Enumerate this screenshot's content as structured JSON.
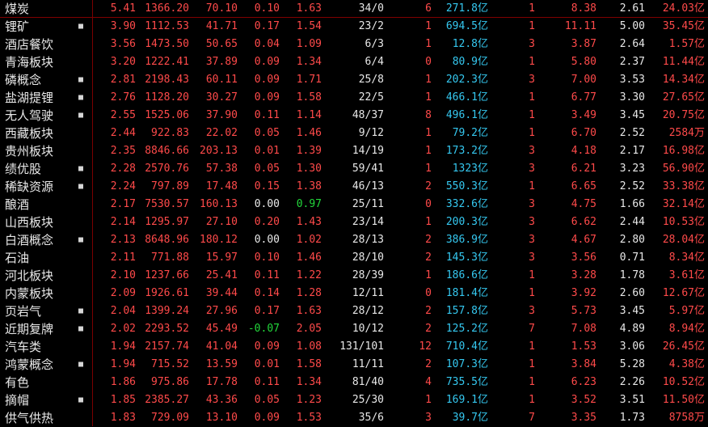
{
  "colors": {
    "up": "#ff4a4a",
    "down": "#22d63a",
    "flat": "#e8e8e8",
    "amount": "#35c8f0",
    "divider": "#7a0000"
  },
  "rows": [
    {
      "name": "煤炭",
      "dot": "",
      "c1": "5.41",
      "c2": "1366.20",
      "c3": "70.10",
      "c4": "0.10",
      "c5": "1.63",
      "c6": "34/0",
      "c7": "6",
      "c8": "271.8亿",
      "c9": "1",
      "c10": "8.38",
      "c11": "2.61",
      "c12": "24.03亿"
    },
    {
      "name": "锂矿",
      "dot": "■",
      "c1": "3.90",
      "c2": "1112.53",
      "c3": "41.71",
      "c4": "0.17",
      "c5": "1.54",
      "c6": "23/2",
      "c7": "1",
      "c8": "694.5亿",
      "c9": "1",
      "c10": "11.11",
      "c11": "5.00",
      "c12": "35.45亿"
    },
    {
      "name": "酒店餐饮",
      "dot": "",
      "c1": "3.56",
      "c2": "1473.50",
      "c3": "50.65",
      "c4": "0.04",
      "c5": "1.09",
      "c6": "6/3",
      "c7": "1",
      "c8": "12.8亿",
      "c9": "3",
      "c10": "3.87",
      "c11": "2.64",
      "c12": "1.57亿"
    },
    {
      "name": "青海板块",
      "dot": "",
      "c1": "3.20",
      "c2": "1222.41",
      "c3": "37.89",
      "c4": "0.09",
      "c5": "1.34",
      "c6": "6/4",
      "c7": "0",
      "c8": "80.9亿",
      "c9": "1",
      "c10": "5.80",
      "c11": "2.37",
      "c12": "11.44亿"
    },
    {
      "name": "磷概念",
      "dot": "■",
      "c1": "2.81",
      "c2": "2198.43",
      "c3": "60.11",
      "c4": "0.09",
      "c5": "1.71",
      "c6": "25/8",
      "c7": "1",
      "c8": "202.3亿",
      "c9": "3",
      "c10": "7.00",
      "c11": "3.53",
      "c12": "14.34亿"
    },
    {
      "name": "盐湖提锂",
      "dot": "■",
      "c1": "2.76",
      "c2": "1128.20",
      "c3": "30.27",
      "c4": "0.09",
      "c5": "1.58",
      "c6": "22/5",
      "c7": "1",
      "c8": "466.1亿",
      "c9": "1",
      "c10": "6.77",
      "c11": "3.30",
      "c12": "27.65亿"
    },
    {
      "name": "无人驾驶",
      "dot": "■",
      "c1": "2.55",
      "c2": "1525.06",
      "c3": "37.90",
      "c4": "0.11",
      "c5": "1.14",
      "c6": "48/37",
      "c7": "8",
      "c8": "496.1亿",
      "c9": "1",
      "c10": "3.49",
      "c11": "3.45",
      "c12": "20.75亿"
    },
    {
      "name": "西藏板块",
      "dot": "",
      "c1": "2.44",
      "c2": "922.83",
      "c3": "22.02",
      "c4": "0.05",
      "c5": "1.46",
      "c6": "9/12",
      "c7": "1",
      "c8": "79.2亿",
      "c9": "1",
      "c10": "6.70",
      "c11": "2.52",
      "c12": "2584万"
    },
    {
      "name": "贵州板块",
      "dot": "",
      "c1": "2.35",
      "c2": "8846.66",
      "c3": "203.13",
      "c4": "0.01",
      "c5": "1.39",
      "c6": "14/19",
      "c7": "1",
      "c8": "173.2亿",
      "c9": "3",
      "c10": "4.18",
      "c11": "2.17",
      "c12": "16.98亿"
    },
    {
      "name": "绩优股",
      "dot": "■",
      "c1": "2.28",
      "c2": "2570.76",
      "c3": "57.38",
      "c4": "0.05",
      "c5": "1.30",
      "c6": "59/41",
      "c7": "1",
      "c8": "1323亿",
      "c9": "3",
      "c10": "6.21",
      "c11": "3.23",
      "c12": "56.90亿"
    },
    {
      "name": "稀缺资源",
      "dot": "■",
      "c1": "2.24",
      "c2": "797.89",
      "c3": "17.48",
      "c4": "0.15",
      "c5": "1.38",
      "c6": "46/13",
      "c7": "2",
      "c8": "550.3亿",
      "c9": "1",
      "c10": "6.65",
      "c11": "2.52",
      "c12": "33.38亿"
    },
    {
      "name": "酿酒",
      "dot": "",
      "c1": "2.17",
      "c2": "7530.57",
      "c3": "160.13",
      "c4": "0.00",
      "c5": "0.97",
      "c6": "25/11",
      "c7": "0",
      "c8": "332.6亿",
      "c9": "3",
      "c10": "4.75",
      "c11": "1.66",
      "c12": "32.14亿"
    },
    {
      "name": "山西板块",
      "dot": "",
      "c1": "2.14",
      "c2": "1295.97",
      "c3": "27.10",
      "c4": "0.20",
      "c5": "1.43",
      "c6": "23/14",
      "c7": "1",
      "c8": "200.3亿",
      "c9": "3",
      "c10": "6.62",
      "c11": "2.44",
      "c12": "10.53亿"
    },
    {
      "name": "白酒概念",
      "dot": "■",
      "c1": "2.13",
      "c2": "8648.96",
      "c3": "180.12",
      "c4": "0.00",
      "c5": "1.02",
      "c6": "28/13",
      "c7": "2",
      "c8": "386.9亿",
      "c9": "3",
      "c10": "4.67",
      "c11": "2.80",
      "c12": "28.04亿"
    },
    {
      "name": "石油",
      "dot": "",
      "c1": "2.11",
      "c2": "771.88",
      "c3": "15.97",
      "c4": "0.10",
      "c5": "1.46",
      "c6": "28/10",
      "c7": "2",
      "c8": "145.3亿",
      "c9": "3",
      "c10": "3.56",
      "c11": "0.71",
      "c12": "8.34亿"
    },
    {
      "name": "河北板块",
      "dot": "",
      "c1": "2.10",
      "c2": "1237.66",
      "c3": "25.41",
      "c4": "0.11",
      "c5": "1.22",
      "c6": "28/39",
      "c7": "1",
      "c8": "186.6亿",
      "c9": "1",
      "c10": "3.28",
      "c11": "1.78",
      "c12": "3.61亿"
    },
    {
      "name": "内蒙板块",
      "dot": "",
      "c1": "2.09",
      "c2": "1926.61",
      "c3": "39.44",
      "c4": "0.14",
      "c5": "1.28",
      "c6": "12/11",
      "c7": "0",
      "c8": "181.4亿",
      "c9": "1",
      "c10": "3.92",
      "c11": "2.60",
      "c12": "12.67亿"
    },
    {
      "name": "页岩气",
      "dot": "■",
      "c1": "2.04",
      "c2": "1399.24",
      "c3": "27.96",
      "c4": "0.17",
      "c5": "1.63",
      "c6": "28/12",
      "c7": "2",
      "c8": "157.8亿",
      "c9": "3",
      "c10": "5.73",
      "c11": "3.45",
      "c12": "5.97亿"
    },
    {
      "name": "近期复牌",
      "dot": "■",
      "c1": "2.02",
      "c2": "2293.52",
      "c3": "45.49",
      "c4": "-0.07",
      "c5": "2.05",
      "c6": "10/12",
      "c7": "2",
      "c8": "125.2亿",
      "c9": "7",
      "c10": "7.08",
      "c11": "4.89",
      "c12": "8.94亿"
    },
    {
      "name": "汽车类",
      "dot": "",
      "c1": "1.94",
      "c2": "2157.74",
      "c3": "41.04",
      "c4": "0.09",
      "c5": "1.08",
      "c6": "131/101",
      "c7": "12",
      "c8": "710.4亿",
      "c9": "1",
      "c10": "1.53",
      "c11": "3.06",
      "c12": "26.45亿"
    },
    {
      "name": "鸿蒙概念",
      "dot": "■",
      "c1": "1.94",
      "c2": "715.52",
      "c3": "13.59",
      "c4": "0.01",
      "c5": "1.58",
      "c6": "11/11",
      "c7": "2",
      "c8": "107.3亿",
      "c9": "1",
      "c10": "3.84",
      "c11": "5.28",
      "c12": "4.38亿"
    },
    {
      "name": "有色",
      "dot": "",
      "c1": "1.86",
      "c2": "975.86",
      "c3": "17.78",
      "c4": "0.11",
      "c5": "1.34",
      "c6": "81/40",
      "c7": "4",
      "c8": "735.5亿",
      "c9": "1",
      "c10": "6.23",
      "c11": "2.26",
      "c12": "10.52亿"
    },
    {
      "name": "摘帽",
      "dot": "■",
      "c1": "1.85",
      "c2": "2385.27",
      "c3": "43.36",
      "c4": "0.05",
      "c5": "1.23",
      "c6": "25/30",
      "c7": "1",
      "c8": "169.1亿",
      "c9": "1",
      "c10": "3.52",
      "c11": "3.51",
      "c12": "11.50亿"
    },
    {
      "name": "供气供热",
      "dot": "",
      "c1": "1.83",
      "c2": "729.09",
      "c3": "13.10",
      "c4": "0.09",
      "c5": "1.53",
      "c6": "35/6",
      "c7": "3",
      "c8": "39.7亿",
      "c9": "7",
      "c10": "3.35",
      "c11": "1.73",
      "c12": "8758万"
    }
  ]
}
